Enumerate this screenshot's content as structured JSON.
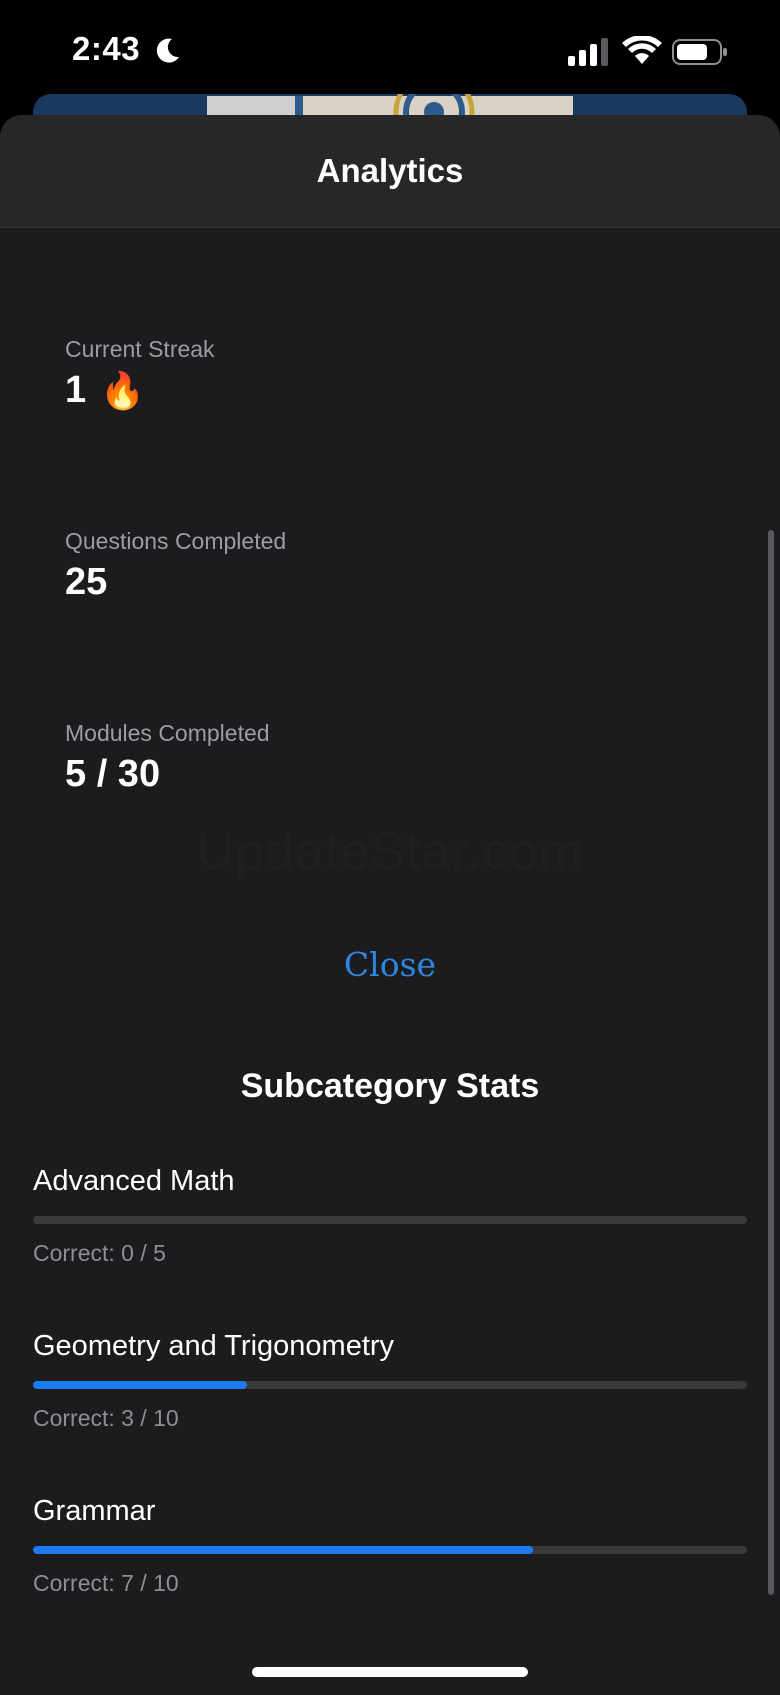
{
  "status_bar": {
    "time": "2:43",
    "icons": [
      "moon-icon",
      "cellular-signal-icon",
      "wifi-icon",
      "battery-icon"
    ]
  },
  "sheet": {
    "title": "Analytics",
    "stats": [
      {
        "label": "Current Streak",
        "value": "1",
        "emoji": "🔥"
      },
      {
        "label": "Questions Completed",
        "value": "25"
      },
      {
        "label": "Modules Completed",
        "value": "5 / 30"
      }
    ],
    "watermark": "UpdateStar.com",
    "close_label": "Close",
    "subcategory_heading": "Subcategory Stats",
    "subcategories": [
      {
        "name": "Advanced Math",
        "correct_text": "Correct: 0 / 5",
        "correct": 0,
        "total": 5
      },
      {
        "name": "Geometry and Trigonometry",
        "correct_text": "Correct: 3 / 10",
        "correct": 3,
        "total": 10
      },
      {
        "name": "Grammar",
        "correct_text": "Correct: 7 / 10",
        "correct": 7,
        "total": 10
      }
    ]
  },
  "colors": {
    "accent": "#1a7cf0",
    "link": "#2f86e0",
    "sheet_bg": "#1c1c1e",
    "track": "#3a3a3c"
  }
}
